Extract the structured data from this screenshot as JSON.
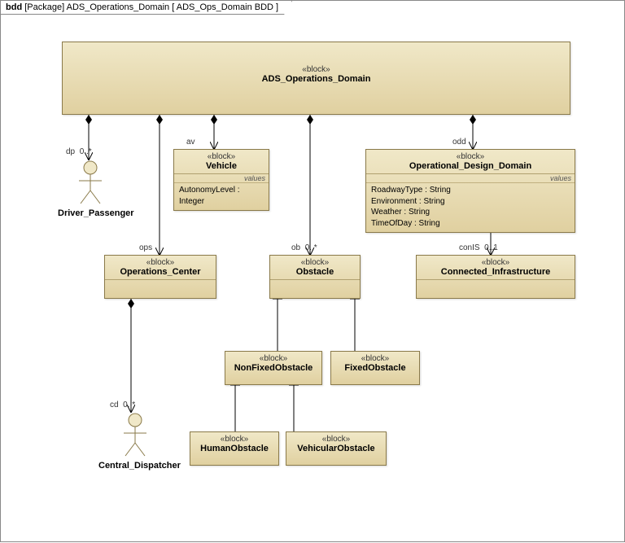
{
  "frame": {
    "kind": "bdd",
    "package_label": "[Package]",
    "package_name": "ADS_Operations_Domain",
    "diagram_name": "ADS_Ops_Domain BDD"
  },
  "blocks": {
    "root": {
      "stereotype": "«block»",
      "name": "ADS_Operations_Domain"
    },
    "vehicle": {
      "stereotype": "«block»",
      "name": "Vehicle",
      "section": "values",
      "attrs": [
        "AutonomyLevel : Integer"
      ]
    },
    "odd": {
      "stereotype": "«block»",
      "name": "Operational_Design_Domain",
      "section": "values",
      "attrs": [
        "RoadwayType : String",
        "Environment : String",
        "Weather : String",
        "TimeOfDay : String"
      ]
    },
    "ops_center": {
      "stereotype": "«block»",
      "name": "Operations_Center"
    },
    "obstacle": {
      "stereotype": "«block»",
      "name": "Obstacle"
    },
    "coninfra": {
      "stereotype": "«block»",
      "name": "Connected_Infrastructure"
    },
    "nonfixed": {
      "stereotype": "«block»",
      "name": "NonFixedObstacle"
    },
    "fixed": {
      "stereotype": "«block»",
      "name": "FixedObstacle"
    },
    "human": {
      "stereotype": "«block»",
      "name": "HumanObstacle"
    },
    "vehicular": {
      "stereotype": "«block»",
      "name": "VehicularObstacle"
    }
  },
  "actors": {
    "driver": {
      "name": "Driver_Passenger"
    },
    "dispatcher": {
      "name": "Central_Dispatcher"
    }
  },
  "roles": {
    "dp": {
      "role": "dp",
      "mult": "0..*"
    },
    "av": {
      "role": "av",
      "mult": ""
    },
    "ob": {
      "role": "ob",
      "mult": "0..*"
    },
    "odd": {
      "role": "odd",
      "mult": ""
    },
    "ops": {
      "role": "ops",
      "mult": ""
    },
    "cd": {
      "role": "cd",
      "mult": "0..*"
    },
    "conIS": {
      "role": "conIS",
      "mult": "0..1"
    }
  }
}
